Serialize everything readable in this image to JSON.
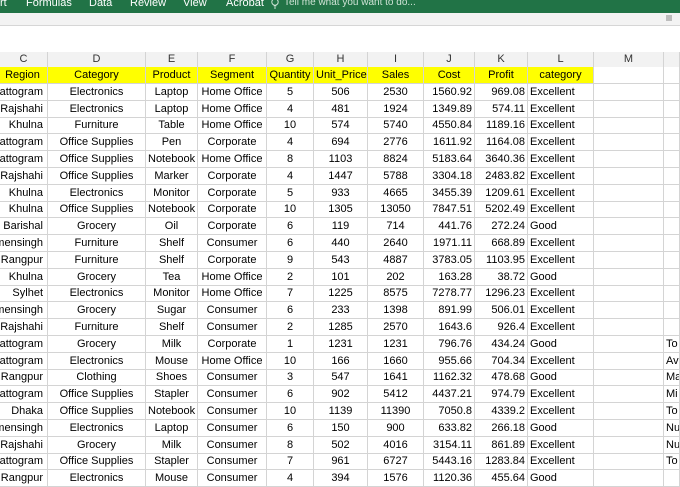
{
  "ribbon": {
    "tabs": [
      "rt",
      "Formulas",
      "Data",
      "Review",
      "View",
      "Acrobat"
    ],
    "tell_me": "Tell me what you want to do...",
    "color": "#217346"
  },
  "columns": [
    "C",
    "D",
    "E",
    "F",
    "G",
    "H",
    "I",
    "J",
    "K",
    "L",
    "M",
    ""
  ],
  "header_row": [
    "Region",
    "Category",
    "Product",
    "Segment",
    "Quantity",
    "Unit_Price",
    "Sales",
    "Cost",
    "Profit",
    "category",
    "",
    ""
  ],
  "header_color": "#ffff00",
  "rows": [
    [
      "Chattogram",
      "Electronics",
      "Laptop",
      "Home Office",
      "5",
      "506",
      "2530",
      "1560.92",
      "969.08",
      "Excellent",
      "",
      ""
    ],
    [
      "Rajshahi",
      "Electronics",
      "Laptop",
      "Home Office",
      "4",
      "481",
      "1924",
      "1349.89",
      "574.11",
      "Excellent",
      "",
      ""
    ],
    [
      "Khulna",
      "Furniture",
      "Table",
      "Home Office",
      "10",
      "574",
      "5740",
      "4550.84",
      "1189.16",
      "Excellent",
      "",
      ""
    ],
    [
      "Chattogram",
      "Office Supplies",
      "Pen",
      "Corporate",
      "4",
      "694",
      "2776",
      "1611.92",
      "1164.08",
      "Excellent",
      "",
      ""
    ],
    [
      "Chattogram",
      "Office Supplies",
      "Notebook",
      "Home Office",
      "8",
      "1103",
      "8824",
      "5183.64",
      "3640.36",
      "Excellent",
      "",
      ""
    ],
    [
      "Rajshahi",
      "Office Supplies",
      "Marker",
      "Corporate",
      "4",
      "1447",
      "5788",
      "3304.18",
      "2483.82",
      "Excellent",
      "",
      ""
    ],
    [
      "Khulna",
      "Electronics",
      "Monitor",
      "Corporate",
      "5",
      "933",
      "4665",
      "3455.39",
      "1209.61",
      "Excellent",
      "",
      ""
    ],
    [
      "Khulna",
      "Office Supplies",
      "Notebook",
      "Corporate",
      "10",
      "1305",
      "13050",
      "7847.51",
      "5202.49",
      "Excellent",
      "",
      ""
    ],
    [
      "Barishal",
      "Grocery",
      "Oil",
      "Corporate",
      "6",
      "119",
      "714",
      "441.76",
      "272.24",
      "Good",
      "",
      ""
    ],
    [
      "Mymensingh",
      "Furniture",
      "Shelf",
      "Consumer",
      "6",
      "440",
      "2640",
      "1971.11",
      "668.89",
      "Excellent",
      "",
      ""
    ],
    [
      "Rangpur",
      "Furniture",
      "Shelf",
      "Corporate",
      "9",
      "543",
      "4887",
      "3783.05",
      "1103.95",
      "Excellent",
      "",
      ""
    ],
    [
      "Khulna",
      "Grocery",
      "Tea",
      "Home Office",
      "2",
      "101",
      "202",
      "163.28",
      "38.72",
      "Good",
      "",
      ""
    ],
    [
      "Sylhet",
      "Electronics",
      "Monitor",
      "Home Office",
      "7",
      "1225",
      "8575",
      "7278.77",
      "1296.23",
      "Excellent",
      "",
      ""
    ],
    [
      "Mymensingh",
      "Grocery",
      "Sugar",
      "Consumer",
      "6",
      "233",
      "1398",
      "891.99",
      "506.01",
      "Excellent",
      "",
      ""
    ],
    [
      "Rajshahi",
      "Furniture",
      "Shelf",
      "Consumer",
      "2",
      "1285",
      "2570",
      "1643.6",
      "926.4",
      "Excellent",
      "",
      ""
    ],
    [
      "Chattogram",
      "Grocery",
      "Milk",
      "Corporate",
      "1",
      "1231",
      "1231",
      "796.76",
      "434.24",
      "Good",
      "",
      "To"
    ],
    [
      "Chattogram",
      "Electronics",
      "Mouse",
      "Home Office",
      "10",
      "166",
      "1660",
      "955.66",
      "704.34",
      "Excellent",
      "",
      "Av"
    ],
    [
      "Rangpur",
      "Clothing",
      "Shoes",
      "Consumer",
      "3",
      "547",
      "1641",
      "1162.32",
      "478.68",
      "Good",
      "",
      "Ma"
    ],
    [
      "Chattogram",
      "Office Supplies",
      "Stapler",
      "Consumer",
      "6",
      "902",
      "5412",
      "4437.21",
      "974.79",
      "Excellent",
      "",
      "Mi"
    ],
    [
      "Dhaka",
      "Office Supplies",
      "Notebook",
      "Consumer",
      "10",
      "1139",
      "11390",
      "7050.8",
      "4339.2",
      "Excellent",
      "",
      "To"
    ],
    [
      "Mymensingh",
      "Electronics",
      "Laptop",
      "Consumer",
      "6",
      "150",
      "900",
      "633.82",
      "266.18",
      "Good",
      "",
      "Nu"
    ],
    [
      "Rajshahi",
      "Grocery",
      "Milk",
      "Consumer",
      "8",
      "502",
      "4016",
      "3154.11",
      "861.89",
      "Excellent",
      "",
      "Nu"
    ],
    [
      "Chattogram",
      "Office Supplies",
      "Stapler",
      "Consumer",
      "7",
      "961",
      "6727",
      "5443.16",
      "1283.84",
      "Excellent",
      "",
      "To"
    ],
    [
      "Rangpur",
      "Electronics",
      "Mouse",
      "Consumer",
      "4",
      "394",
      "1576",
      "1120.36",
      "455.64",
      "Good",
      "",
      ""
    ]
  ]
}
